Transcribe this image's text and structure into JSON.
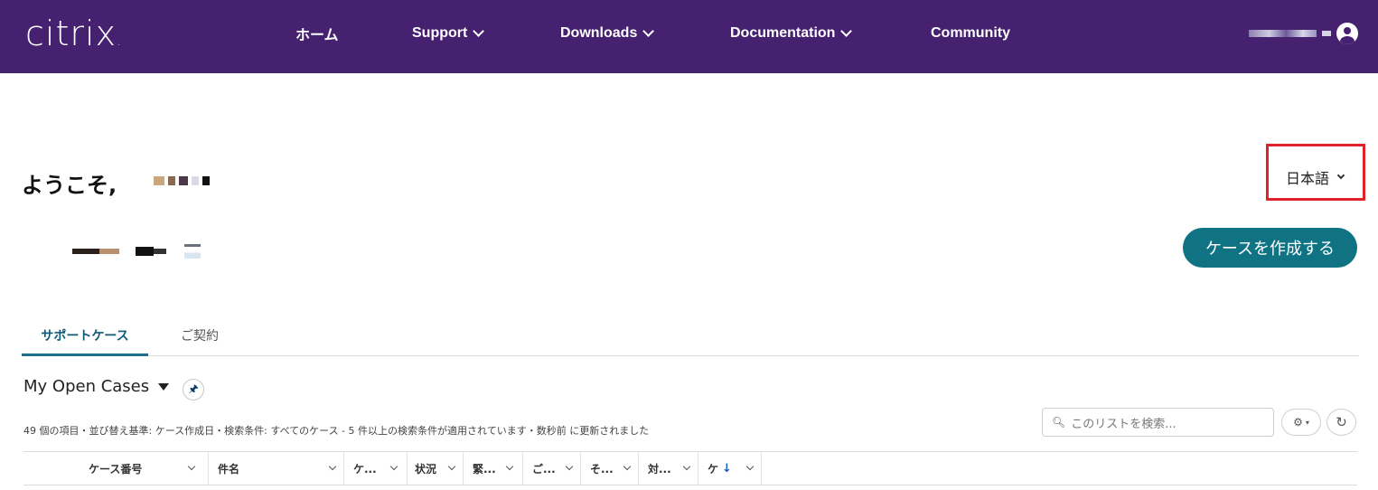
{
  "header": {
    "logo_text": "citrix",
    "logo_dot": ".",
    "nav": [
      {
        "label": "ホーム",
        "has_dropdown": false
      },
      {
        "label": "Support",
        "has_dropdown": true
      },
      {
        "label": "Downloads",
        "has_dropdown": true
      },
      {
        "label": "Documentation",
        "has_dropdown": true
      },
      {
        "label": "Community",
        "has_dropdown": false
      }
    ],
    "background_color": "#452170"
  },
  "welcome": {
    "greeting": "ようこそ,"
  },
  "language_selector": {
    "label": "日本語",
    "highlight_color": "#e0232b"
  },
  "create_case_button": {
    "label": "ケースを作成する",
    "color": "#0f7384"
  },
  "tabs": [
    {
      "label": "サポートケース",
      "active": true
    },
    {
      "label": "ご契約",
      "active": false
    }
  ],
  "list_view": {
    "title": "My Open Cases",
    "pin_icon": "pin-icon",
    "summary": "49 個の項目・並び替え基準: ケース作成日・検索条件: すべてのケース - 5 件以上の検索条件が適用されています・数秒前 に更新されました",
    "search_placeholder": "このリストを検索...",
    "columns": [
      {
        "label": "ケース番号"
      },
      {
        "label": "件名"
      },
      {
        "label": "ケ..."
      },
      {
        "label": "状況"
      },
      {
        "label": "緊..."
      },
      {
        "label": "ご..."
      },
      {
        "label": "そ..."
      },
      {
        "label": "対..."
      },
      {
        "label": "ケ",
        "sort": "↓"
      }
    ]
  }
}
